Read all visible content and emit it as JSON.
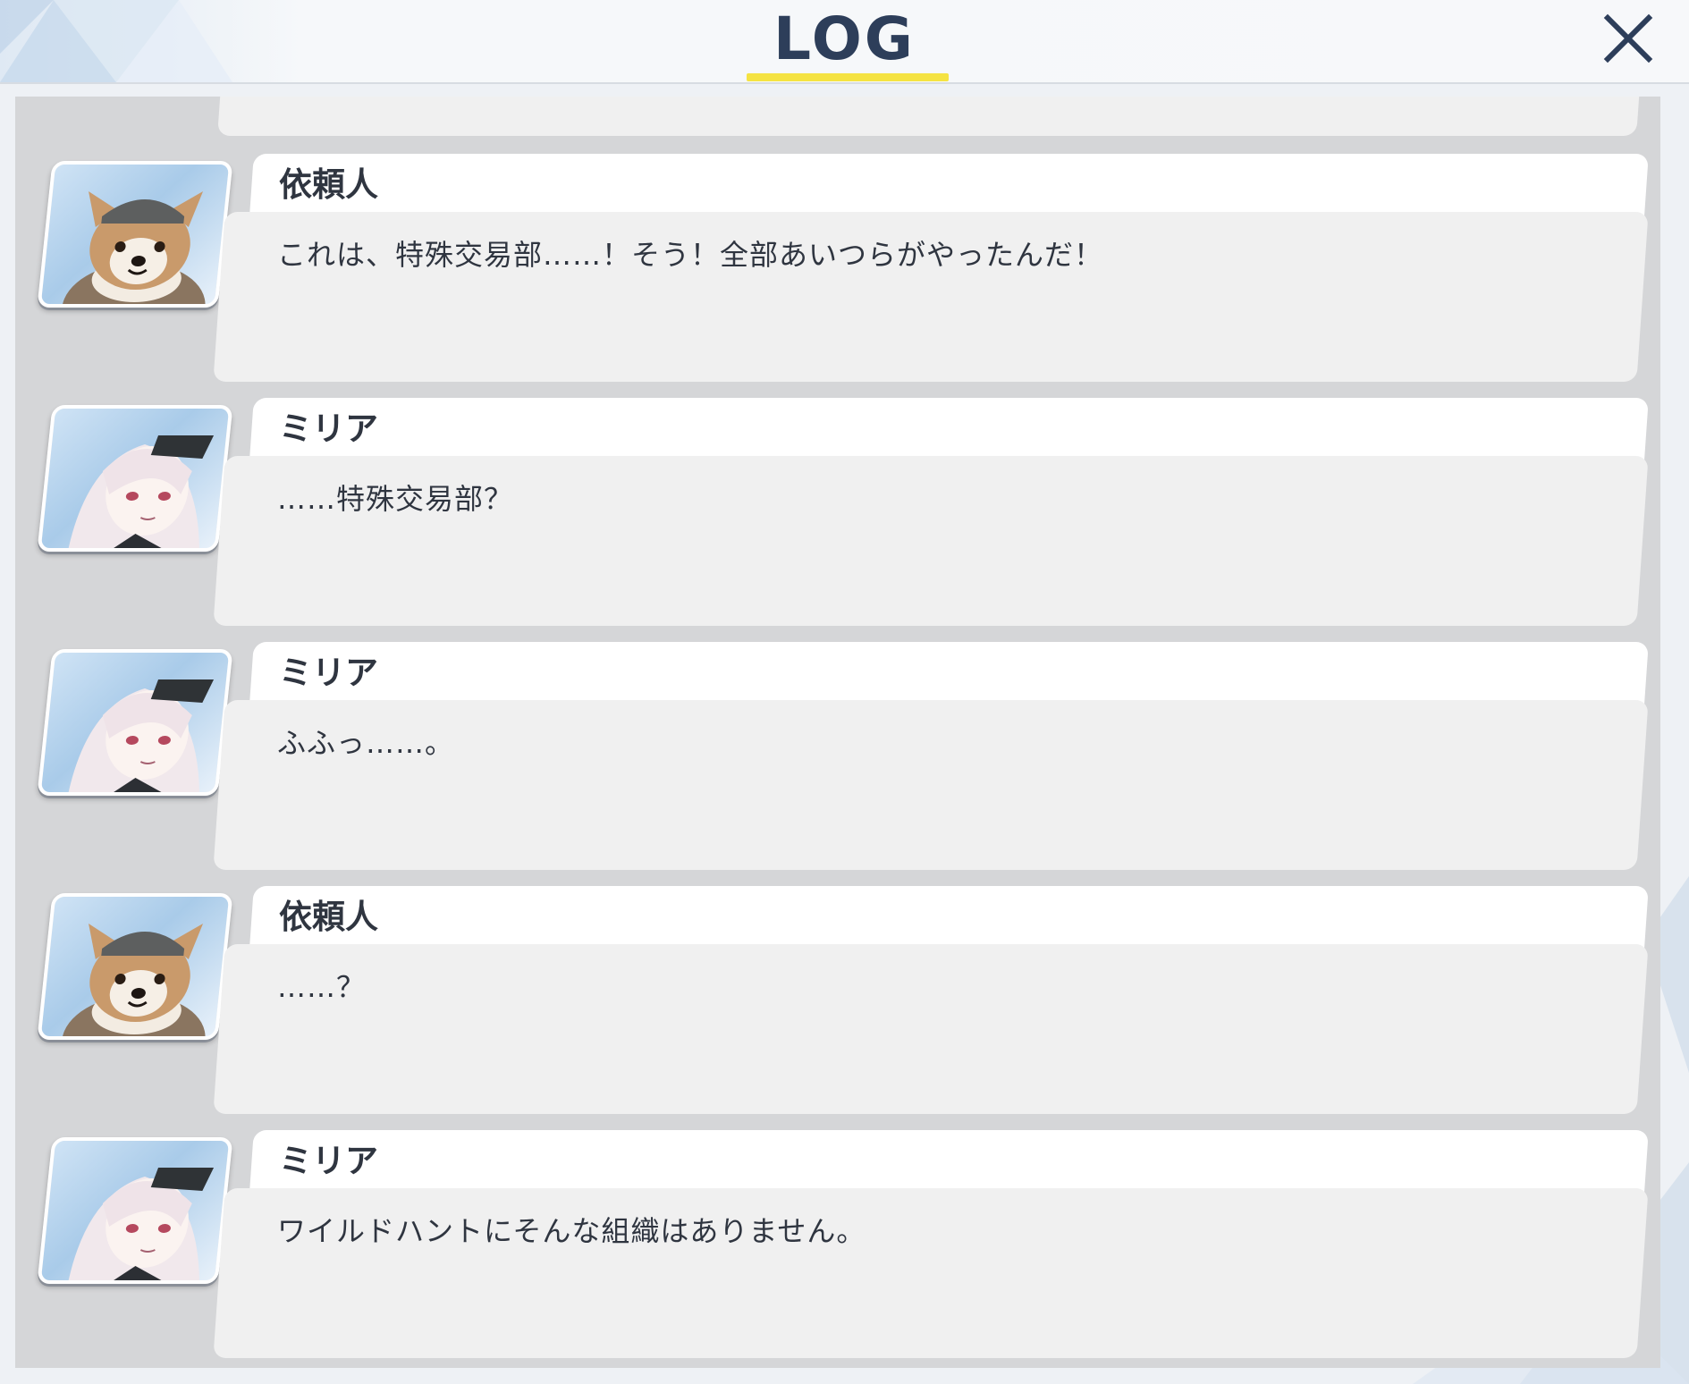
{
  "header": {
    "title": "LOG",
    "close_icon": "close-icon"
  },
  "colors": {
    "title": "#2d3e5a",
    "underline": "#f5e342",
    "panel": "#d5d6d8",
    "bubble": "#f0f0f0",
    "name_box": "#ffffff"
  },
  "log": {
    "entries": [
      {
        "speaker": "依頼人",
        "avatar": "dog-avatar-icon",
        "text": "これは、特殊交易部……！そう！全部あいつらがやったんだ！"
      },
      {
        "speaker": "ミリア",
        "avatar": "milia-avatar-icon",
        "text": "……特殊交易部？"
      },
      {
        "speaker": "ミリア",
        "avatar": "milia-avatar-icon",
        "text": "ふふっ……。"
      },
      {
        "speaker": "依頼人",
        "avatar": "dog-avatar-icon",
        "text": "……？"
      },
      {
        "speaker": "ミリア",
        "avatar": "milia-avatar-icon",
        "text": "ワイルドハントにそんな組織はありません。"
      }
    ]
  }
}
